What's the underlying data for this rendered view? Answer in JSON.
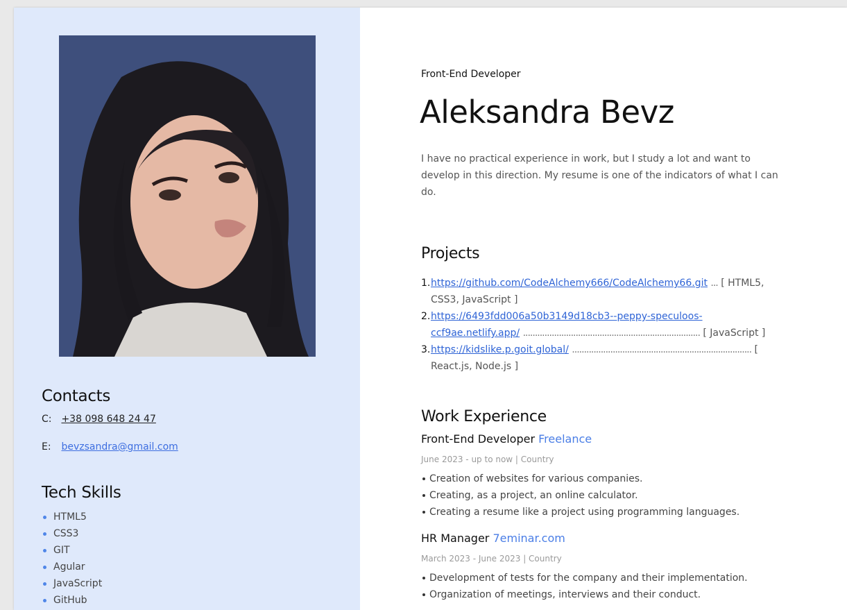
{
  "sidebar": {
    "contacts_heading": "Contacts",
    "phone_label": "C:",
    "phone": "+38 098 648 24 47",
    "email_label": "E:",
    "email": "bevzsandra@gmail.com",
    "skills_heading": "Tech Skills",
    "skills": [
      "HTML5",
      "CSS3",
      "GIT",
      "Agular",
      "JavaScript",
      "GitHub"
    ]
  },
  "header": {
    "job_title": "Front-End Developer",
    "name": "Aleksandra Bevz",
    "about": "I have no practical experience in work, but I study a lot and want to develop in this direction. My resume is one of the indicators of what I can do."
  },
  "projects": {
    "heading": "Projects",
    "items": [
      {
        "num": "1.",
        "url": "https://github.com/CodeAlchemy666/CodeAlchemy66.git",
        "dots": "...",
        "tech": "[ HTML5, CSS3, JavaScript ]"
      },
      {
        "num": "2.",
        "url": "https://6493fdd006a50b3149d18cb3--peppy-speculoos-ccf9ae.netlify.app/",
        "dots": "..........................................................................",
        "tech": "[ JavaScript ]"
      },
      {
        "num": "3.",
        "url": "https://kidslike.p.goit.global/",
        "dots": "...........................................................................",
        "tech": "[ React.js, Node.js ]"
      }
    ]
  },
  "work": {
    "heading": "Work Experience",
    "jobs": [
      {
        "role": "Front-End Developer",
        "company": "Freelance",
        "dates": "June 2023 - up to now | Country",
        "bullets": [
          "Creation of websites for various companies.",
          "Creating, as a project, an online calculator.",
          "Creating a resume like a project using programming languages."
        ]
      },
      {
        "role": "HR Manager",
        "company": "7eminar.com",
        "dates": "March 2023 - June 2023 | Country",
        "bullets": [
          "Development of tests for the company and their implementation.",
          "Organization of meetings, interviews and their conduct."
        ]
      }
    ]
  },
  "colors": {
    "sidebar_bg": "#dfe9fb",
    "accent": "#4a7ee6",
    "link": "#2f64d6"
  }
}
